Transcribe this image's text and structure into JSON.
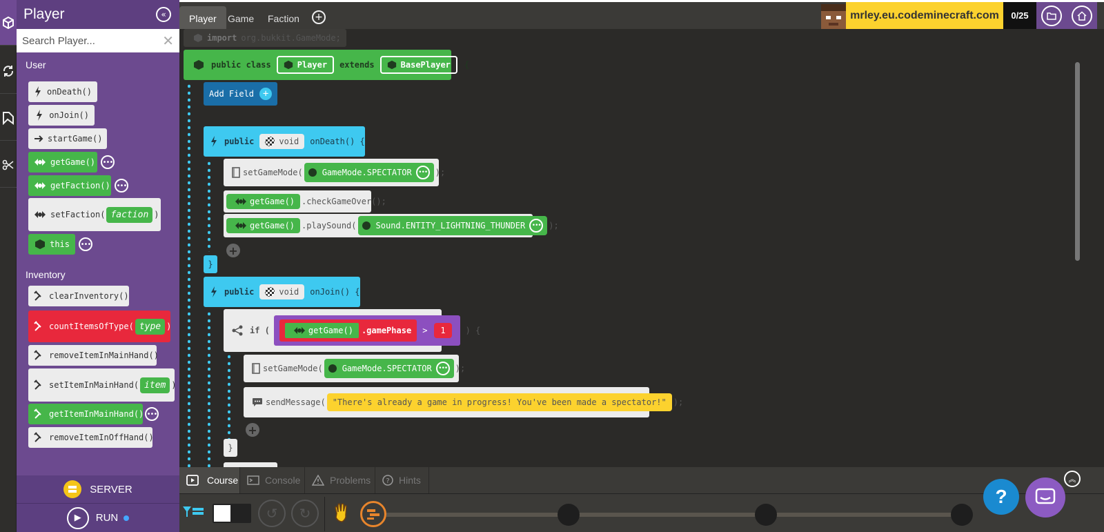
{
  "palette": {
    "title": "Player",
    "search_placeholder": "Search Player...",
    "categories": {
      "user": "User",
      "inventory": "Inventory"
    },
    "user_blocks": [
      {
        "label": "onDeath()",
        "icon": "lightning-icon"
      },
      {
        "label": "onJoin()",
        "icon": "lightning-icon"
      },
      {
        "label": "startGame()",
        "icon": "arrow-right-icon"
      },
      {
        "label": "getGame()",
        "icon": "game-controller-icon"
      },
      {
        "label": "getFaction()",
        "icon": "game-controller-icon"
      },
      {
        "label": "setFaction(",
        "slot": "faction",
        "suffix": ")",
        "icon": "game-controller-icon"
      },
      {
        "label": "this",
        "icon": "cube-icon"
      }
    ],
    "inventory_blocks": [
      {
        "label": "clearInventory()",
        "icon": "pickaxe-icon"
      },
      {
        "label": "countItemsOfType(",
        "slot": "type",
        "suffix": ")",
        "icon": "pickaxe-icon"
      },
      {
        "label": "removeItemInMainHand()",
        "icon": "pickaxe-icon"
      },
      {
        "label": "setItemInMainHand(",
        "slot": "item",
        "suffix": ")",
        "icon": "pickaxe-icon"
      },
      {
        "label": "getItemInMainHand()",
        "icon": "pickaxe-icon"
      },
      {
        "label": "removeItemInOffHand()",
        "icon": "pickaxe-icon"
      }
    ]
  },
  "server": {
    "label": "SERVER"
  },
  "run": {
    "label": "RUN"
  },
  "tabs": [
    "Player",
    "Game",
    "Faction"
  ],
  "topbar": {
    "server_name": "mrley.eu.codeminecraft.com",
    "progress": "0/25"
  },
  "code": {
    "import_kw": "import",
    "import_path": "org.bukkit.GameMode;",
    "class_decl": {
      "public_class": "public class",
      "name": "Player",
      "extends": "extends",
      "parent": "BasePlayer",
      "brace": "{"
    },
    "add_field": "Add Field",
    "public": "public",
    "void": "void",
    "on_death": "onDeath() {",
    "on_join": "onJoin() {",
    "set_game_mode": "setGameMode(",
    "spectator": "GameMode.SPECTATOR",
    "close_semi": ");",
    "get_game": "getGame()",
    "check_game_over": ".checkGameOver();",
    "play_sound": ".playSound(",
    "sound": "Sound.ENTITY_LIGHTNING_THUNDER",
    "close_brace": "}",
    "if_kw": "if (",
    "game_phase": ".gamePhase",
    "gt": ">",
    "one": "1",
    "if_close": ") {",
    "send_message": "sendMessage(",
    "message": "\"There's already a game in progress! You've been made a spectator!\""
  },
  "bottom_tabs": [
    "Course",
    "Console",
    "Problems",
    "Hints"
  ],
  "help": "?"
}
